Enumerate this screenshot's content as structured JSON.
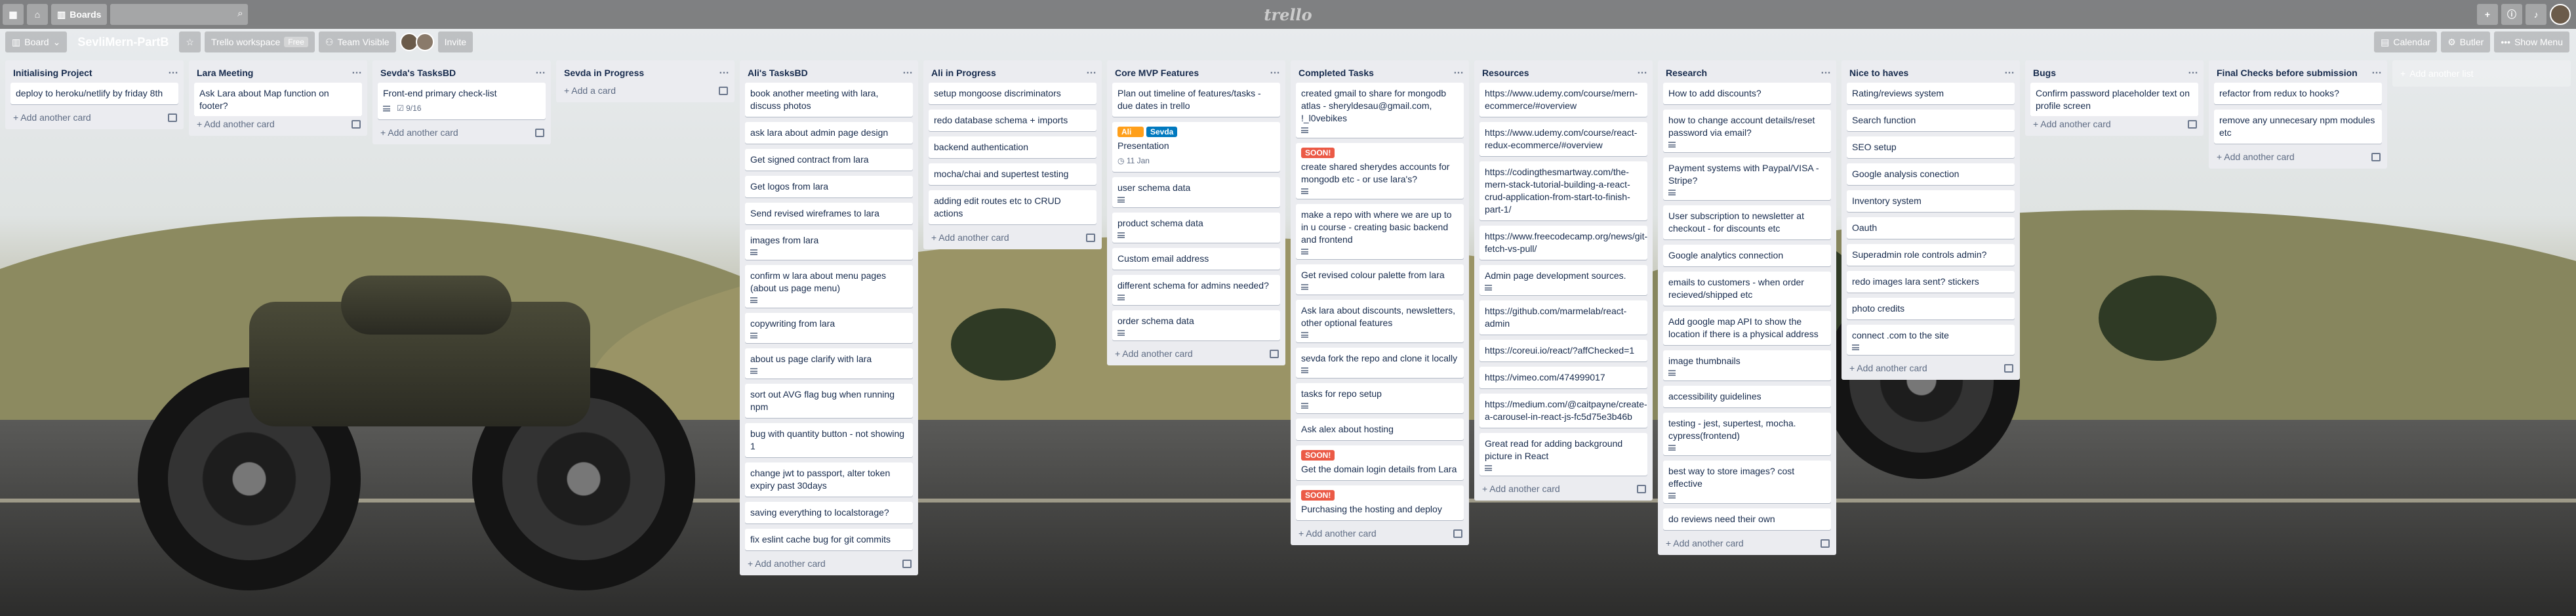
{
  "topbar": {
    "boards_label": "Boards",
    "logo": "trello",
    "home_icon": "home-icon",
    "apps_icon": "grid-icon",
    "search_icon": "magnifier-icon",
    "add_icon": "plus-icon",
    "info_icon": "info-icon",
    "bell_icon": "bell-icon"
  },
  "board": {
    "view_label": "Board",
    "title": "SevliMern-PartB",
    "workspace_label": "Trello workspace",
    "workspace_badge": "Free",
    "visibility_label": "Team Visible",
    "invite_label": "Invite",
    "calendar_label": "Calendar",
    "butler_label": "Butler",
    "menu_label": "Show Menu"
  },
  "colors": {
    "label_orange": "#ff9f1a",
    "label_blue": "#0079bf",
    "label_red": "#eb5a46"
  },
  "lists": [
    {
      "title": "Initialising Project",
      "cards": [
        {
          "text": "deploy to heroku/netlify by friday 8th"
        }
      ],
      "add_label": "Add another card"
    },
    {
      "title": "Lara Meeting",
      "cards": [
        {
          "text": "Ask Lara about Map function on footer?"
        }
      ],
      "add_label": "Add another card"
    },
    {
      "title": "Sevda's TasksBD",
      "cards": [
        {
          "text": "Front-end primary check-list",
          "checklist": "9/16",
          "desc": true
        }
      ],
      "add_label": "Add another card"
    },
    {
      "title": "Sevda in Progress",
      "cards": [],
      "add_label": "Add a card"
    },
    {
      "title": "Ali's TasksBD",
      "cards": [
        {
          "text": "book another meeting with lara, discuss photos"
        },
        {
          "text": "ask lara about admin page design"
        },
        {
          "text": "Get signed contract from lara"
        },
        {
          "text": "Get logos from lara"
        },
        {
          "text": "Send revised wireframes to lara"
        },
        {
          "text": "images from lara",
          "desc": true
        },
        {
          "text": "confirm w lara about menu pages (about us page menu)",
          "desc": true
        },
        {
          "text": "copywriting from lara",
          "desc": true
        },
        {
          "text": "about us page clarify with lara",
          "desc": true
        },
        {
          "text": "sort out AVG flag bug when running npm"
        },
        {
          "text": "bug with quantity button - not showing 1"
        },
        {
          "text": "change jwt to passport, alter token expiry past 30days"
        },
        {
          "text": "saving everything to localstorage?"
        },
        {
          "text": "fix eslint cache bug for git commits"
        }
      ],
      "add_label": "Add another card"
    },
    {
      "title": "Ali in Progress",
      "cards": [
        {
          "text": "setup mongoose discriminators"
        },
        {
          "text": "redo database schema + imports"
        },
        {
          "text": "backend authentication"
        },
        {
          "text": "mocha/chai and supertest testing"
        },
        {
          "text": "adding edit routes etc to CRUD actions"
        }
      ],
      "add_label": "Add another card"
    },
    {
      "title": "Core MVP Features",
      "cards": [
        {
          "text": "Plan out timeline of features/tasks - due dates in trello"
        },
        {
          "text": "Presentation",
          "labels": [
            {
              "text": "Ali",
              "color": "#ff9f1a"
            },
            {
              "text": "Sevda",
              "color": "#0079bf"
            }
          ],
          "due": "11 Jan"
        },
        {
          "text": "user schema data",
          "desc": true
        },
        {
          "text": "product schema data",
          "desc": true
        },
        {
          "text": "Custom email address"
        },
        {
          "text": "different schema for admins needed?",
          "desc": true
        },
        {
          "text": "order schema data",
          "desc": true
        }
      ],
      "add_label": "Add another card"
    },
    {
      "title": "Completed Tasks",
      "cards": [
        {
          "text": "created gmail to share for mongodb atlas - sheryldesau@gmail.com, !_l0vebikes",
          "desc": true
        },
        {
          "text": "create shared sherydes accounts for mongodb etc - or use lara's?",
          "labels": [
            {
              "text": "SOON!",
              "color": "#eb5a46"
            }
          ],
          "desc": true
        },
        {
          "text": "make a repo with where we are up to in u course - creating basic backend and frontend",
          "desc": true
        },
        {
          "text": "Get revised colour palette from lara",
          "desc": true
        },
        {
          "text": "Ask lara about discounts, newsletters, other optional features",
          "desc": true
        },
        {
          "text": "sevda fork the repo and clone it locally",
          "desc": true
        },
        {
          "text": "tasks for repo setup",
          "desc": true
        },
        {
          "text": "Ask alex about hosting"
        },
        {
          "text": "Get the domain login details from Lara",
          "labels": [
            {
              "text": "SOON!",
              "color": "#eb5a46"
            }
          ]
        },
        {
          "text": "Purchasing the hosting and deploy",
          "labels": [
            {
              "text": "SOON!",
              "color": "#eb5a46"
            }
          ]
        }
      ],
      "add_label": "Add another card"
    },
    {
      "title": "Resources",
      "cards": [
        {
          "text": "https://www.udemy.com/course/mern-ecommerce/#overview"
        },
        {
          "text": "https://www.udemy.com/course/react-redux-ecommerce/#overview"
        },
        {
          "text": "https://codingthesmartway.com/the-mern-stack-tutorial-building-a-react-crud-application-from-start-to-finish-part-1/"
        },
        {
          "text": "https://www.freecodecamp.org/news/git-fetch-vs-pull/"
        },
        {
          "text": "Admin page development sources.",
          "desc": true
        },
        {
          "text": "https://github.com/marmelab/react-admin"
        },
        {
          "text": "https://coreui.io/react/?affChecked=1"
        },
        {
          "text": "https://vimeo.com/474999017"
        },
        {
          "text": "https://medium.com/@caitpayne/create-a-carousel-in-react-js-fc5d75e3b46b"
        },
        {
          "text": "Great read for adding background picture in React",
          "desc": true
        }
      ],
      "add_label": "Add another card"
    },
    {
      "title": "Research",
      "cards": [
        {
          "text": "How to add discounts?"
        },
        {
          "text": "how to change account details/reset password via email?",
          "desc": true
        },
        {
          "text": "Payment systems with Paypal/VISA - Stripe?",
          "desc": true
        },
        {
          "text": "User subscription to newsletter at checkout - for discounts etc"
        },
        {
          "text": "Google analytics connection"
        },
        {
          "text": "emails to customers - when order recieved/shipped etc"
        },
        {
          "text": "Add google map API to show the location if there is a physical address"
        },
        {
          "text": "image thumbnails",
          "desc": true
        },
        {
          "text": "accessibility guidelines"
        },
        {
          "text": "testing - jest, supertest, mocha. cypress(frontend)",
          "desc": true
        },
        {
          "text": "best way to store images? cost effective",
          "desc": true
        },
        {
          "text": "do reviews need their own"
        }
      ],
      "add_label": "Add another card"
    },
    {
      "title": "Nice to haves",
      "cards": [
        {
          "text": "Rating/reviews system"
        },
        {
          "text": "Search function"
        },
        {
          "text": "SEO setup"
        },
        {
          "text": "Google analysis conection"
        },
        {
          "text": "Inventory system"
        },
        {
          "text": "Oauth"
        },
        {
          "text": "Superadmin role controls admin?"
        },
        {
          "text": "redo images lara sent? stickers"
        },
        {
          "text": "photo credits"
        },
        {
          "text": "connect .com to the site",
          "desc": true
        }
      ],
      "add_label": "Add another card"
    },
    {
      "title": "Bugs",
      "cards": [
        {
          "text": "Confirm password placeholder text on profile screen"
        }
      ],
      "add_label": "Add another card"
    },
    {
      "title": "Final Checks before submission",
      "cards": [
        {
          "text": "refactor from redux to hooks?"
        },
        {
          "text": "remove any unnecesary npm modules etc"
        }
      ],
      "add_label": "Add another card"
    }
  ],
  "add_list_label": "Add another list"
}
